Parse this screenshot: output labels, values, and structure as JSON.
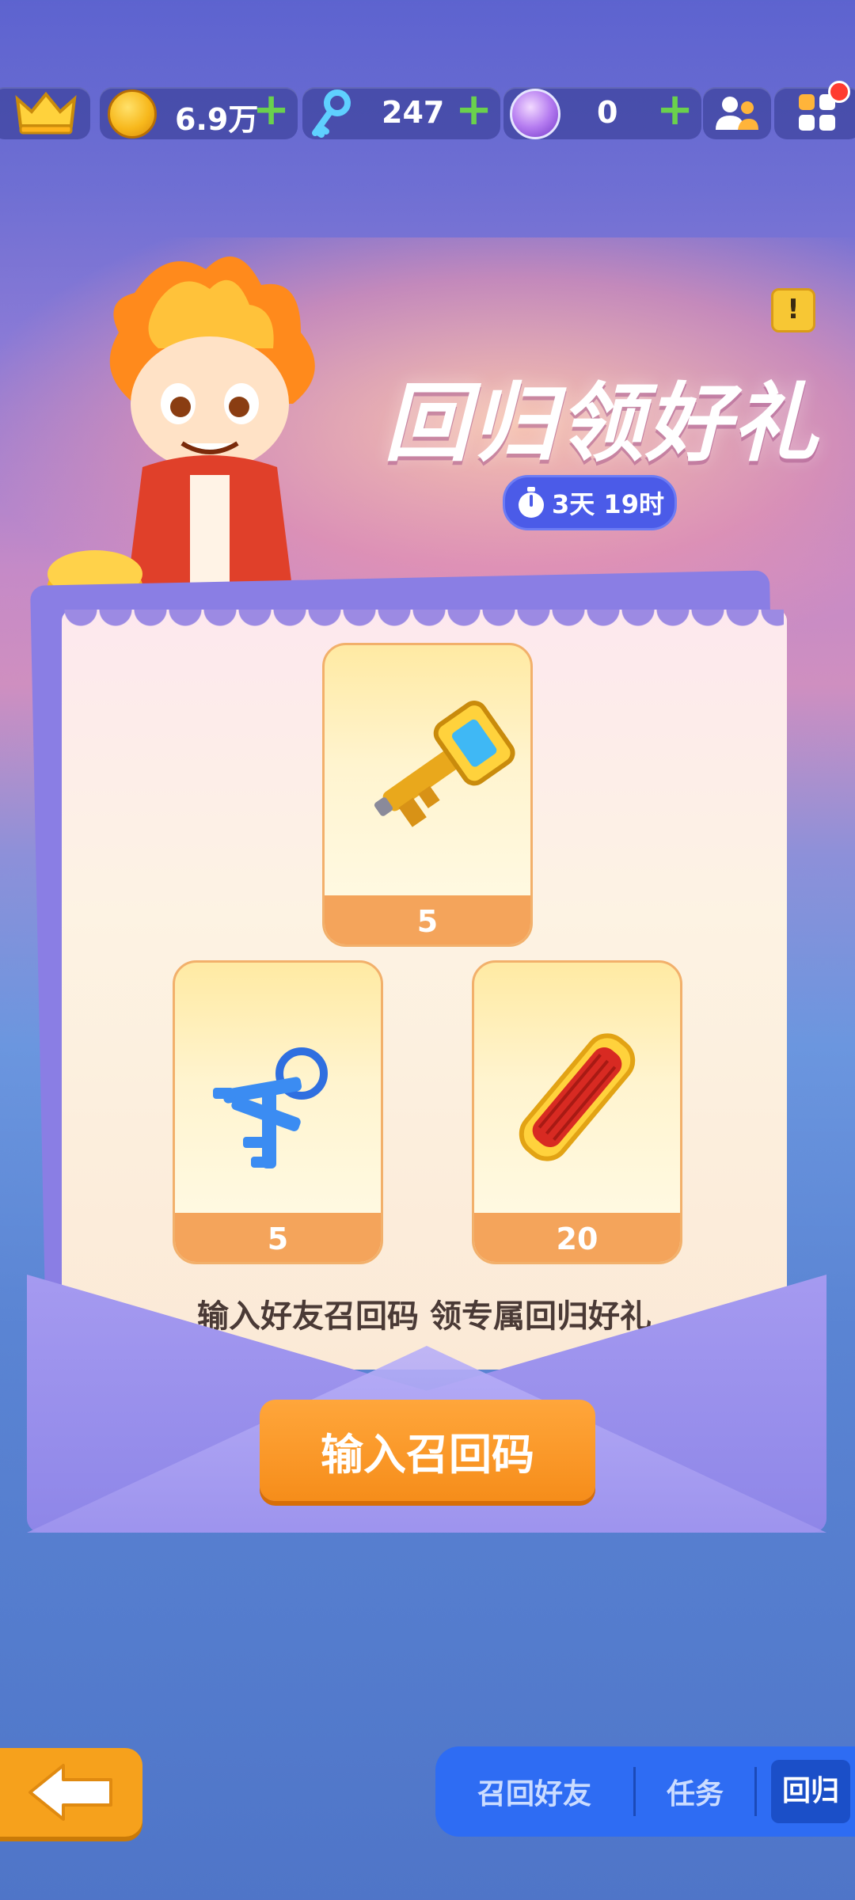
{
  "top_bar": {
    "coins": {
      "icon": "gold-coin-icon",
      "value": "6.9万"
    },
    "keys": {
      "icon": "key-icon",
      "value": "247"
    },
    "gems": {
      "icon": "purple-orb-icon",
      "value": "0"
    },
    "plus_glyph": "+",
    "notification_dot_color": "#ff3b30"
  },
  "banner": {
    "title": "回归领好礼",
    "timer": "3天 19时",
    "alert_glyph": "!"
  },
  "rewards": [
    {
      "icon": "golden-key-icon",
      "count": "5"
    },
    {
      "icon": "blue-key-bunch-icon",
      "count": "5"
    },
    {
      "icon": "red-firecracker-icon",
      "count": "20"
    }
  ],
  "hint_text": "输入好友召回码 领专属回归好礼",
  "cta_label": "输入召回码",
  "bottom_nav": {
    "tabs": [
      {
        "label": "召回好友",
        "active": false
      },
      {
        "label": "任务",
        "active": false
      },
      {
        "label": "回归",
        "active": true
      }
    ]
  },
  "colors": {
    "accent_orange": "#f68d1a",
    "tab_blue": "#2e6cf3",
    "card_foot": "#f4a45b"
  }
}
